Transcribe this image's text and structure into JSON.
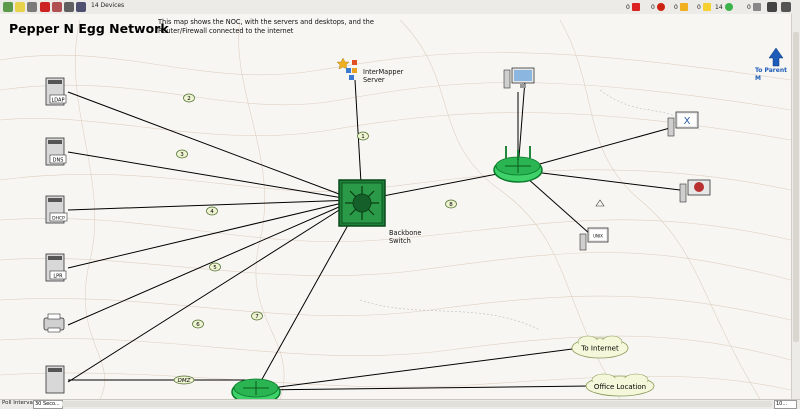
{
  "toolbar": {
    "device_count": "14 Devices",
    "status_counts": {
      "red": "0",
      "critical": "0",
      "warning": "0",
      "alarm": "0",
      "ok": "14",
      "unknown": "0"
    }
  },
  "map": {
    "title": "Pepper N Egg Network",
    "description": "This map shows the NOC, with the servers and desktops, and the Router/Firewall connected to the internet",
    "intermapper_label_line1": "InterMapper",
    "intermapper_label_line2": "Server",
    "backbone_label_line1": "Backbone",
    "backbone_label_line2": "Switch",
    "parent_link": "To Parent M",
    "cloud_internet": "To Internet",
    "cloud_office": "Office Location",
    "devices": {
      "ldap": "LDAP",
      "dns": "DNS",
      "dhcp": "DHCP",
      "lpr": "LPR",
      "unix": "UNIX"
    },
    "link_numbers": [
      "1",
      "2",
      "3",
      "4",
      "5",
      "6",
      "7",
      "8"
    ],
    "dmz_label": "DMZ"
  },
  "statusbar": {
    "poll_label": "Poll Interval:",
    "poll_value": "30 Seco...",
    "zoom_value": "10..."
  },
  "colors": {
    "switch_green": "#1e7f3a",
    "switch_light": "#3fd26a",
    "cloud_fill": "#f4f7d9",
    "link_circle": "#eef3d2",
    "parent_arrow": "#1e5bb8"
  }
}
